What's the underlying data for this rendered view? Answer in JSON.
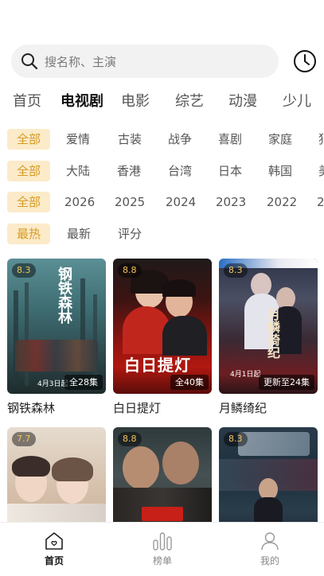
{
  "search": {
    "placeholder": "搜名称、主演",
    "icon": "search-icon"
  },
  "header": {
    "history_icon": "clock-icon"
  },
  "tabs": [
    {
      "label": "首页",
      "active": false
    },
    {
      "label": "电视剧",
      "active": true
    },
    {
      "label": "电影",
      "active": false
    },
    {
      "label": "综艺",
      "active": false
    },
    {
      "label": "动漫",
      "active": false
    },
    {
      "label": "少儿",
      "active": false
    }
  ],
  "filters": {
    "genre": [
      "全部",
      "爱情",
      "古装",
      "战争",
      "喜剧",
      "家庭",
      "犯"
    ],
    "region": [
      "全部",
      "大陆",
      "香港",
      "台湾",
      "日本",
      "韩国",
      "美"
    ],
    "year": [
      "全部",
      "2026",
      "2025",
      "2024",
      "2023",
      "2022",
      "2"
    ],
    "sort": [
      "最热",
      "最新",
      "评分"
    ]
  },
  "cards": [
    {
      "title": "钢铁森林",
      "score": "8.3",
      "episodes": "全28集",
      "poster_text": "钢铁森林",
      "poster_sub": "4月3日起"
    },
    {
      "title": "白日提灯",
      "score": "8.8",
      "episodes": "全40集",
      "poster_text": "白日提灯",
      "poster_sub": ""
    },
    {
      "title": "月鳞绮纪",
      "score": "8.3",
      "episodes": "更新至24集",
      "poster_text": "月鳞绮纪",
      "poster_sub": "4月1日起"
    },
    {
      "title": "",
      "score": "7.7",
      "episodes": "",
      "poster_text": "",
      "poster_sub": ""
    },
    {
      "title": "",
      "score": "8.8",
      "episodes": "",
      "poster_text": "",
      "poster_sub": ""
    },
    {
      "title": "",
      "score": "8.3",
      "episodes": "",
      "poster_text": "",
      "poster_sub": ""
    }
  ],
  "bottom_nav": [
    {
      "label": "首页",
      "icon": "home-icon",
      "active": true
    },
    {
      "label": "榜单",
      "icon": "ranking-icon",
      "active": false
    },
    {
      "label": "我的",
      "icon": "profile-icon",
      "active": false
    }
  ],
  "colors": {
    "accent": "#d79a22",
    "accent_bg": "#fbebc9",
    "score": "#f2c35c"
  }
}
